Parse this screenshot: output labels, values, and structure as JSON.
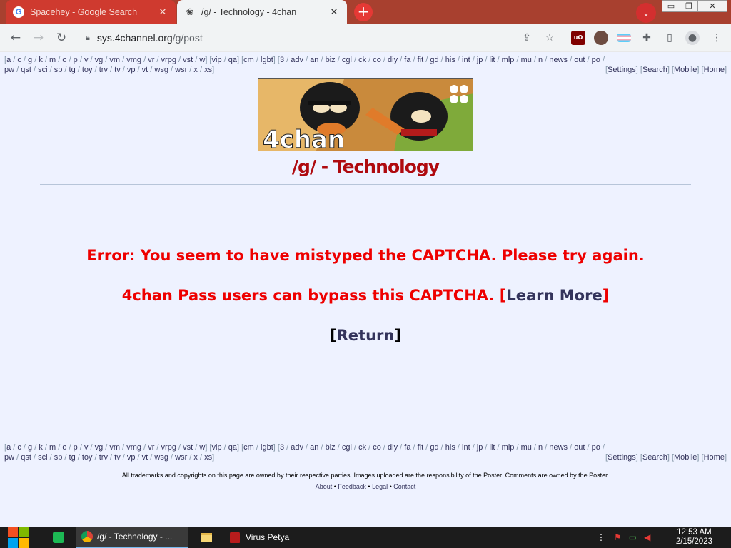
{
  "browser": {
    "tabs": [
      {
        "title": "Spacehey - Google Search",
        "favicon": "google-icon",
        "active": false
      },
      {
        "title": "/g/ - Technology - 4chan",
        "favicon": "clover-icon",
        "active": true
      }
    ],
    "new_tab_glyph": "+",
    "tab_search_glyph": "⌄",
    "close_glyph": "✕",
    "window_buttons": {
      "minimize": "▭",
      "restore": "❐",
      "close": "✕"
    },
    "url_host": "sys.4channel.org",
    "url_path": "/g/post",
    "extensions": [
      "ublock-origin-icon",
      "avatar-extension-icon",
      "trans-flag-extension-icon",
      "puzzle-extensions-icon",
      "side-panel-icon",
      "profile-icon"
    ]
  },
  "page": {
    "boardlist_row1": [
      "a",
      "c",
      "g",
      "k",
      "m",
      "o",
      "p",
      "v",
      "vg",
      "vm",
      "vmg",
      "vr",
      "vrpg",
      "vst",
      "w"
    ],
    "boardlist_row1_group2": [
      "vip",
      "qa"
    ],
    "boardlist_row1_group3": [
      "cm",
      "lgbt"
    ],
    "boardlist_row1_group4": [
      "3",
      "adv",
      "an",
      "biz",
      "cgl",
      "ck",
      "co",
      "diy",
      "fa",
      "fit",
      "gd",
      "his",
      "int",
      "jp",
      "lit",
      "mlp",
      "mu",
      "n",
      "news",
      "out",
      "po"
    ],
    "boardlist_row2": [
      "pw",
      "qst",
      "sci",
      "sp",
      "tg",
      "toy",
      "trv",
      "tv",
      "vp",
      "vt",
      "wsg",
      "wsr",
      "x",
      "xs"
    ],
    "nav_links": [
      "Settings",
      "Search",
      "Mobile",
      "Home"
    ],
    "banner_text": "4chan",
    "board_title": "/g/ - Technology",
    "error_line1": "Error: You seem to have mistyped the CAPTCHA. Please try again.",
    "error_line2": "4chan Pass users can bypass this CAPTCHA. ",
    "learn_more": "Learn More",
    "return_label": "Return",
    "open_bracket": "[",
    "close_bracket": "]",
    "footer_disclaimer": "All trademarks and copyrights on this page are owned by their respective parties. Images uploaded are the responsibility of the Poster. Comments are owned by the Poster.",
    "footer_links": [
      "About",
      "Feedback",
      "Legal",
      "Contact"
    ],
    "footer_link_sep": " • "
  },
  "taskbar": {
    "items": [
      {
        "label": "/g/ - Technology - ...",
        "icon": "chrome-icon",
        "active": true
      },
      {
        "label": "",
        "icon": "folder-icon",
        "active": false
      },
      {
        "label": "Virus Petya",
        "icon": "petya-skull-icon",
        "active": false
      }
    ],
    "time": "12:53 AM",
    "date": "2/15/2023"
  },
  "colors": {
    "board_title": "#af0a0f",
    "error_text": "#ee0000",
    "link": "#34345c",
    "page_bg": "#eef2ff",
    "tab_strip": "#a8402f"
  }
}
